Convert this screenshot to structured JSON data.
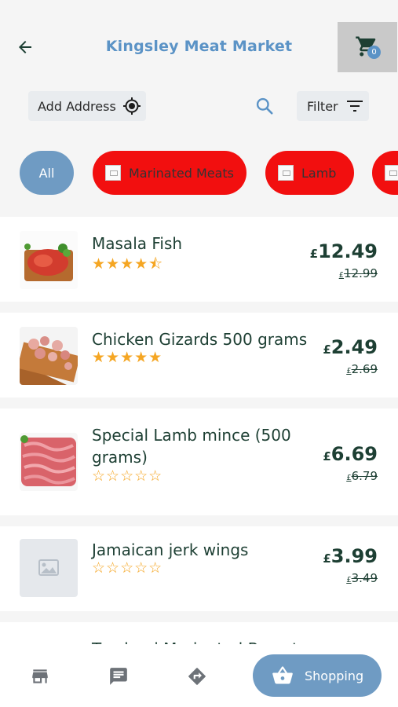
{
  "header": {
    "title": "Kingsley Meat  Market",
    "cart_count": "0"
  },
  "toolbar": {
    "address_label": "Add Address",
    "filter_label": "Filter"
  },
  "categories": [
    {
      "label": "All",
      "active": true
    },
    {
      "label": "Marinated Meats"
    },
    {
      "label": "Lamb"
    },
    {
      "label": ""
    }
  ],
  "products": [
    {
      "name": "Masala Fish",
      "rating": 4.5,
      "stars": "★★★★⯪",
      "currency": "£",
      "price": "12.49",
      "old_price": "12.99"
    },
    {
      "name": "Chicken Gizards 500 grams",
      "rating": 5,
      "stars": "★★★★★",
      "currency": "£",
      "price": "2.49",
      "old_price": "2.69"
    },
    {
      "name": "Special Lamb mince (500 grams)",
      "rating": 0,
      "stars": "☆☆☆☆☆",
      "currency": "£",
      "price": "6.69",
      "old_price": "6.79"
    },
    {
      "name": "Jamaican jerk wings",
      "rating": 0,
      "stars": "☆☆☆☆☆",
      "currency": "£",
      "price": "3.99",
      "old_price": "3.49"
    },
    {
      "name": "Tandoori Marinated Breast"
    }
  ],
  "bottom_nav": {
    "shopping_label": "Shopping"
  },
  "colors": {
    "accent": "#6f9bc3",
    "title": "#5b93c6",
    "category_chip": "#f20f0f",
    "star": "#f5a623",
    "text": "#1d3f33"
  }
}
